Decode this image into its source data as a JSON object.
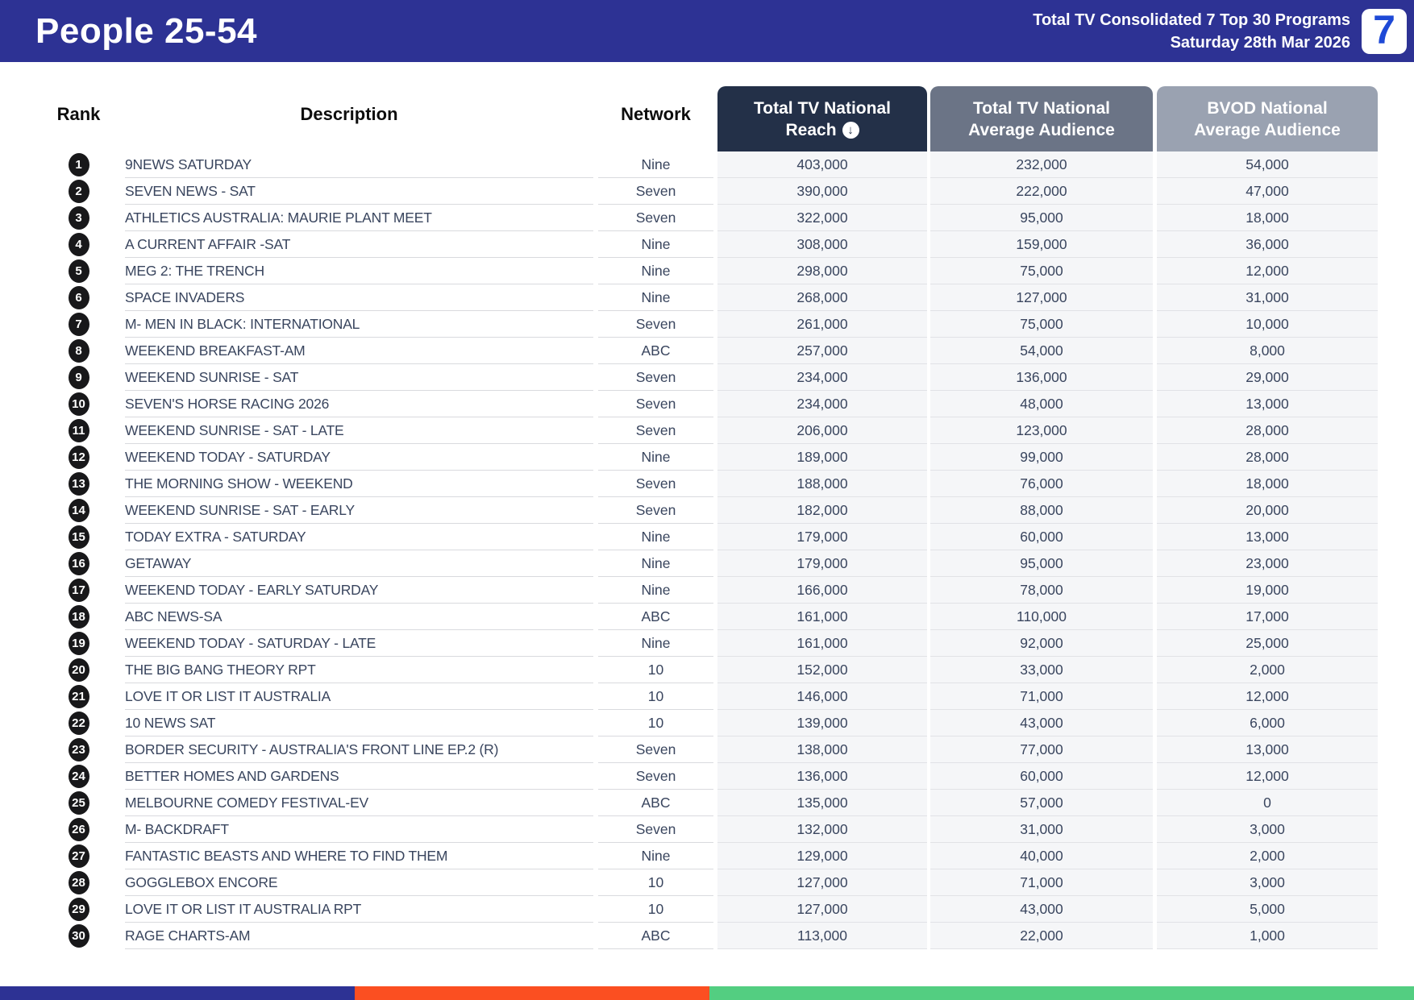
{
  "header": {
    "title": "People 25-54",
    "report_title": "Total TV Consolidated 7 Top 30 Programs",
    "report_date": "Saturday 28th Mar 2026",
    "logo_text": "7"
  },
  "table": {
    "headers": {
      "rank": "Rank",
      "description": "Description",
      "network": "Network",
      "reach_line1": "Total TV National",
      "reach_line2": "Reach",
      "avg_line1": "Total TV National",
      "avg_line2": "Average Audience",
      "bvod_line1": "BVOD National",
      "bvod_line2": "Average Audience"
    },
    "sort_icon_glyph": "↓",
    "rows": [
      {
        "rank": 1,
        "description": "9NEWS SATURDAY",
        "network": "Nine",
        "reach": "403,000",
        "avg": "232,000",
        "bvod": "54,000"
      },
      {
        "rank": 2,
        "description": "SEVEN NEWS - SAT",
        "network": "Seven",
        "reach": "390,000",
        "avg": "222,000",
        "bvod": "47,000"
      },
      {
        "rank": 3,
        "description": "ATHLETICS AUSTRALIA: MAURIE PLANT MEET",
        "network": "Seven",
        "reach": "322,000",
        "avg": "95,000",
        "bvod": "18,000"
      },
      {
        "rank": 4,
        "description": "A CURRENT AFFAIR -SAT",
        "network": "Nine",
        "reach": "308,000",
        "avg": "159,000",
        "bvod": "36,000"
      },
      {
        "rank": 5,
        "description": "MEG 2: THE TRENCH",
        "network": "Nine",
        "reach": "298,000",
        "avg": "75,000",
        "bvod": "12,000"
      },
      {
        "rank": 6,
        "description": "SPACE INVADERS",
        "network": "Nine",
        "reach": "268,000",
        "avg": "127,000",
        "bvod": "31,000"
      },
      {
        "rank": 7,
        "description": "M- MEN IN BLACK: INTERNATIONAL",
        "network": "Seven",
        "reach": "261,000",
        "avg": "75,000",
        "bvod": "10,000"
      },
      {
        "rank": 8,
        "description": "WEEKEND BREAKFAST-AM",
        "network": "ABC",
        "reach": "257,000",
        "avg": "54,000",
        "bvod": "8,000"
      },
      {
        "rank": 9,
        "description": "WEEKEND SUNRISE - SAT",
        "network": "Seven",
        "reach": "234,000",
        "avg": "136,000",
        "bvod": "29,000"
      },
      {
        "rank": 10,
        "description": "SEVEN'S HORSE RACING 2026",
        "network": "Seven",
        "reach": "234,000",
        "avg": "48,000",
        "bvod": "13,000"
      },
      {
        "rank": 11,
        "description": "WEEKEND SUNRISE - SAT - LATE",
        "network": "Seven",
        "reach": "206,000",
        "avg": "123,000",
        "bvod": "28,000"
      },
      {
        "rank": 12,
        "description": "WEEKEND TODAY - SATURDAY",
        "network": "Nine",
        "reach": "189,000",
        "avg": "99,000",
        "bvod": "28,000"
      },
      {
        "rank": 13,
        "description": "THE MORNING SHOW - WEEKEND",
        "network": "Seven",
        "reach": "188,000",
        "avg": "76,000",
        "bvod": "18,000"
      },
      {
        "rank": 14,
        "description": "WEEKEND SUNRISE - SAT - EARLY",
        "network": "Seven",
        "reach": "182,000",
        "avg": "88,000",
        "bvod": "20,000"
      },
      {
        "rank": 15,
        "description": "TODAY EXTRA - SATURDAY",
        "network": "Nine",
        "reach": "179,000",
        "avg": "60,000",
        "bvod": "13,000"
      },
      {
        "rank": 16,
        "description": "GETAWAY",
        "network": "Nine",
        "reach": "179,000",
        "avg": "95,000",
        "bvod": "23,000"
      },
      {
        "rank": 17,
        "description": "WEEKEND TODAY - EARLY SATURDAY",
        "network": "Nine",
        "reach": "166,000",
        "avg": "78,000",
        "bvod": "19,000"
      },
      {
        "rank": 18,
        "description": "ABC NEWS-SA",
        "network": "ABC",
        "reach": "161,000",
        "avg": "110,000",
        "bvod": "17,000"
      },
      {
        "rank": 19,
        "description": "WEEKEND TODAY - SATURDAY - LATE",
        "network": "Nine",
        "reach": "161,000",
        "avg": "92,000",
        "bvod": "25,000"
      },
      {
        "rank": 20,
        "description": "THE BIG BANG THEORY RPT",
        "network": "10",
        "reach": "152,000",
        "avg": "33,000",
        "bvod": "2,000"
      },
      {
        "rank": 21,
        "description": "LOVE IT OR LIST IT AUSTRALIA",
        "network": "10",
        "reach": "146,000",
        "avg": "71,000",
        "bvod": "12,000"
      },
      {
        "rank": 22,
        "description": "10 NEWS SAT",
        "network": "10",
        "reach": "139,000",
        "avg": "43,000",
        "bvod": "6,000"
      },
      {
        "rank": 23,
        "description": "BORDER SECURITY - AUSTRALIA'S FRONT LINE EP.2 (R)",
        "network": "Seven",
        "reach": "138,000",
        "avg": "77,000",
        "bvod": "13,000"
      },
      {
        "rank": 24,
        "description": "BETTER HOMES AND GARDENS",
        "network": "Seven",
        "reach": "136,000",
        "avg": "60,000",
        "bvod": "12,000"
      },
      {
        "rank": 25,
        "description": "MELBOURNE COMEDY FESTIVAL-EV",
        "network": "ABC",
        "reach": "135,000",
        "avg": "57,000",
        "bvod": "0"
      },
      {
        "rank": 26,
        "description": "M- BACKDRAFT",
        "network": "Seven",
        "reach": "132,000",
        "avg": "31,000",
        "bvod": "3,000"
      },
      {
        "rank": 27,
        "description": "FANTASTIC BEASTS AND WHERE TO FIND THEM",
        "network": "Nine",
        "reach": "129,000",
        "avg": "40,000",
        "bvod": "2,000"
      },
      {
        "rank": 28,
        "description": "GOGGLEBOX ENCORE",
        "network": "10",
        "reach": "127,000",
        "avg": "71,000",
        "bvod": "3,000"
      },
      {
        "rank": 29,
        "description": "LOVE IT OR LIST IT AUSTRALIA RPT",
        "network": "10",
        "reach": "127,000",
        "avg": "43,000",
        "bvod": "5,000"
      },
      {
        "rank": 30,
        "description": "RAGE CHARTS-AM",
        "network": "ABC",
        "reach": "113,000",
        "avg": "22,000",
        "bvod": "1,000"
      }
    ]
  },
  "colors": {
    "banner_blue": "#2d3294",
    "reach_header_bg": "#233048",
    "avg_header_bg": "#6b7486",
    "bvod_header_bg": "#9aa2b1",
    "footer_segment_1": "#2d3294",
    "footer_segment_2": "#fb4f21",
    "footer_segment_3": "#53ce81"
  }
}
